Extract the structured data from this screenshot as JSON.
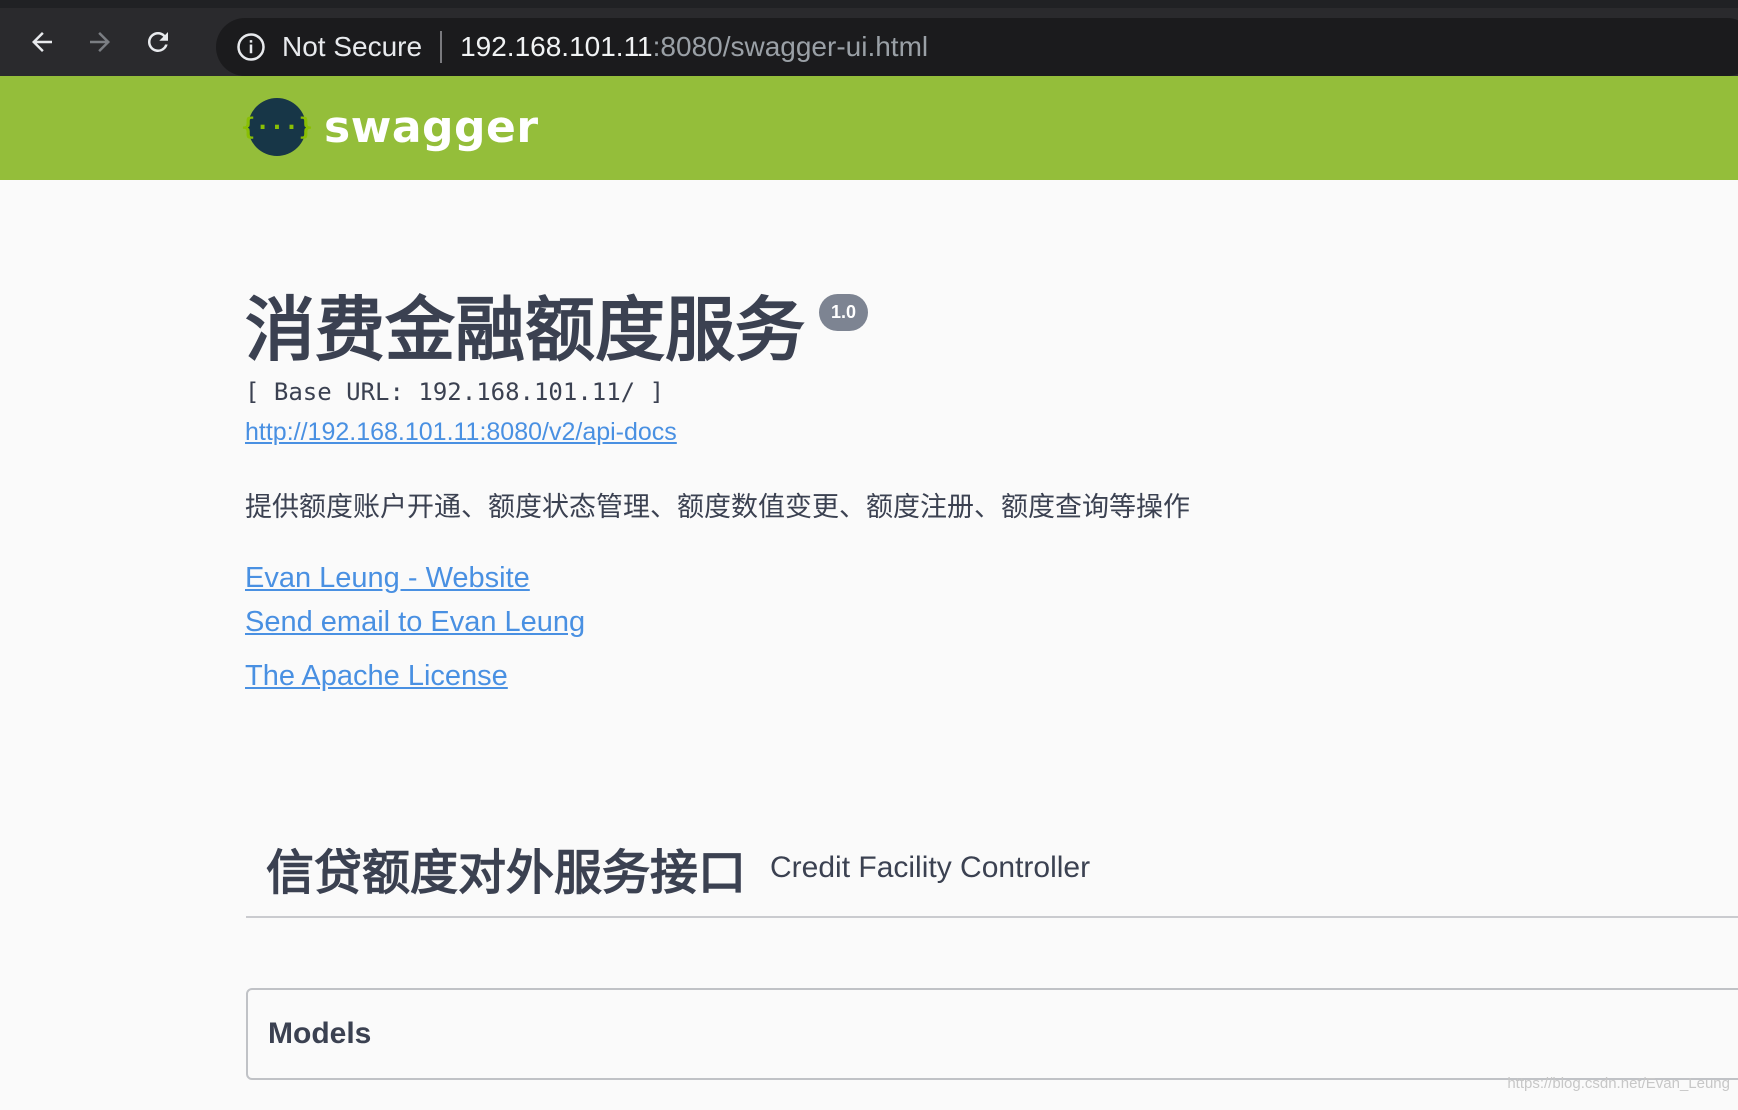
{
  "browser": {
    "security_label": "Not Secure",
    "url_host": "192.168.101.11",
    "url_rest": ":8080/swagger-ui.html"
  },
  "topbar": {
    "logo_glyph": "{···}",
    "logo_text": "swagger"
  },
  "info": {
    "title": "消费金融额度服务",
    "version": "1.0",
    "base_url": "[ Base URL: 192.168.101.11/ ]",
    "api_docs_link": "http://192.168.101.11:8080/v2/api-docs",
    "description": "提供额度账户开通、额度状态管理、额度数值变更、额度注册、额度查询等操作",
    "contact_website": "Evan Leung - Website",
    "contact_email": "Send email to Evan Leung",
    "license": "The Apache License"
  },
  "tag": {
    "name": "信贷额度对外服务接口",
    "description": "Credit Facility Controller"
  },
  "models": {
    "title": "Models"
  },
  "watermark": "https://blog.csdn.net/Evan_Leung",
  "colors": {
    "topbar": "#94be3a",
    "link": "#4990e2",
    "text": "#3b4151",
    "version_badge": "#7d8492"
  },
  "icons": [
    "back-arrow-icon",
    "forward-arrow-icon",
    "reload-icon",
    "info-icon",
    "swagger-logo-icon"
  ]
}
